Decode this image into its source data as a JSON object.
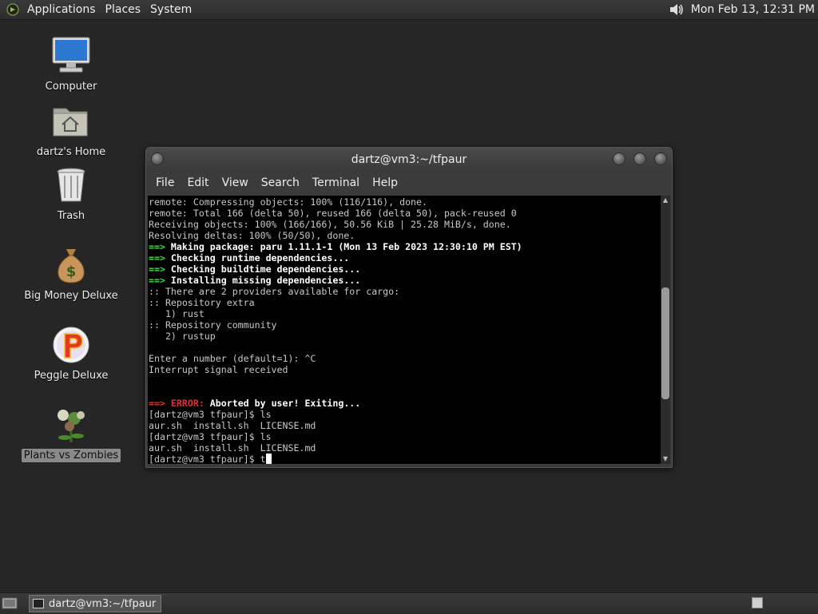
{
  "top_panel": {
    "menus": [
      "Applications",
      "Places",
      "System"
    ],
    "clock": "Mon Feb 13, 12:31 PM",
    "logo_icon": "distro-logo-icon",
    "volume_icon": "volume-icon"
  },
  "desktop": {
    "icons": [
      {
        "label": "Computer",
        "icon": "computer-icon"
      },
      {
        "label": "dartz's Home",
        "icon": "home-folder-icon"
      },
      {
        "label": "Trash",
        "icon": "trash-icon"
      },
      {
        "label": "Big Money Deluxe",
        "icon": "money-bag-icon"
      },
      {
        "label": "Peggle Deluxe",
        "icon": "peggle-icon"
      },
      {
        "label": "Plants vs Zombies",
        "icon": "plants-vs-zombies-icon",
        "selected": true
      }
    ]
  },
  "terminal": {
    "title": "dartz@vm3:~/tfpaur",
    "menu": [
      "File",
      "Edit",
      "View",
      "Search",
      "Terminal",
      "Help"
    ],
    "lines": [
      [
        {
          "t": "remote: Compressing objects: 100% (116/116), done."
        }
      ],
      [
        {
          "t": "remote: Total 166 (delta 50), reused 166 (delta 50), pack-reused 0"
        }
      ],
      [
        {
          "t": "Receiving objects: 100% (166/166), 50.56 KiB | 25.28 MiB/s, done."
        }
      ],
      [
        {
          "t": "Resolving deltas: 100% (50/50), done."
        }
      ],
      [
        {
          "t": "==> ",
          "c": "arrow"
        },
        {
          "t": "Making package: paru 1.11.1-1 (Mon 13 Feb 2023 12:30:10 PM EST)",
          "c": "bold"
        }
      ],
      [
        {
          "t": "==> ",
          "c": "arrow"
        },
        {
          "t": "Checking runtime dependencies...",
          "c": "bold"
        }
      ],
      [
        {
          "t": "==> ",
          "c": "arrow"
        },
        {
          "t": "Checking buildtime dependencies...",
          "c": "bold"
        }
      ],
      [
        {
          "t": "==> ",
          "c": "arrow"
        },
        {
          "t": "Installing missing dependencies...",
          "c": "bold"
        }
      ],
      [
        {
          "t": ":: There are 2 providers available for cargo:"
        }
      ],
      [
        {
          "t": ":: Repository extra"
        }
      ],
      [
        {
          "t": "   1) rust"
        }
      ],
      [
        {
          "t": ":: Repository community"
        }
      ],
      [
        {
          "t": "   2) rustup"
        }
      ],
      [
        {
          "t": ""
        }
      ],
      [
        {
          "t": "Enter a number (default=1): ^C"
        }
      ],
      [
        {
          "t": "Interrupt signal received"
        }
      ],
      [
        {
          "t": ""
        }
      ],
      [
        {
          "t": ""
        }
      ],
      [
        {
          "t": "==> ",
          "c": "err"
        },
        {
          "t": "ERROR: ",
          "c": "err"
        },
        {
          "t": "Aborted by user! Exiting...",
          "c": "bold"
        }
      ],
      [
        {
          "t": "[dartz@vm3 tfpaur]$ ls"
        }
      ],
      [
        {
          "t": "aur.sh  install.sh  LICENSE.md"
        }
      ],
      [
        {
          "t": "[dartz@vm3 tfpaur]$ ls"
        }
      ],
      [
        {
          "t": "aur.sh  install.sh  LICENSE.md"
        }
      ],
      [
        {
          "t": "[dartz@vm3 tfpaur]$ t"
        }
      ]
    ],
    "scroll_position": 0.6
  },
  "bottom_panel": {
    "task_label": "dartz@vm3:~/tfpaur",
    "show_desktop_icon": "show-desktop-icon",
    "workspace_icon": "workspace-switcher-icon"
  }
}
